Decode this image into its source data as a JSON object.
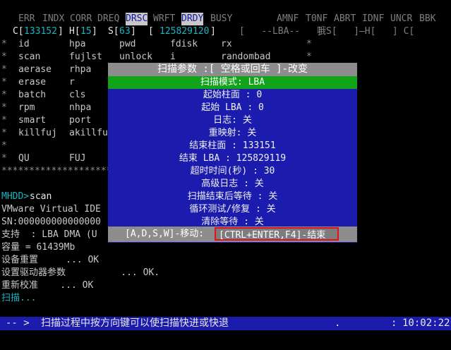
{
  "status_flags": {
    "err": "ERR",
    "indx": "INDX",
    "corr": "CORR",
    "dreq": "DREQ",
    "drsc": "DRSC",
    "wrft": "WRFT",
    "drdy": "DRDY",
    "busy": "BUSY",
    "amnf": "AMNF",
    "t0nf": "T0NF",
    "abrt": "ABRT",
    "idnf": "IDNF",
    "uncr": "UNCR",
    "bbk": "BBK"
  },
  "chs_line": {
    "c_label": "C[",
    "c_value": "133152",
    "c_close": "]",
    "h_label": "H[",
    "h_value": "15",
    "h_close": "]",
    "s_label": "S[",
    "s_value": "63",
    "s_close": "]",
    "lba_open": "[",
    "lba_value": "125829120",
    "lba_close": "]",
    "lba_box": "[   --LBA--   ]",
    "tail": "哦S[   ]—H[   ] C[       ]"
  },
  "command_menu": {
    "rows": [
      [
        "id",
        "hpa",
        "pwd",
        "fdisk",
        "rx"
      ],
      [
        "scan",
        "fujlst",
        "unlock",
        "i",
        "randombad"
      ],
      [
        "aerase",
        "rhpa",
        "",
        "",
        ""
      ],
      [
        "erase",
        "r",
        "",
        "",
        ""
      ],
      [
        "batch",
        "cls",
        "",
        "",
        ""
      ],
      [
        "rpm",
        "nhpa",
        "",
        "",
        ""
      ],
      [
        "smart",
        "port",
        "",
        "",
        ""
      ],
      [
        "killfuj",
        "akillfu",
        "",
        "",
        ""
      ],
      [
        "",
        "",
        "",
        "",
        ""
      ],
      [
        "QU",
        "FUJ",
        "",
        "",
        ""
      ]
    ],
    "star": "*",
    "separator": "**************************"
  },
  "console": {
    "prompt": "MHDD>",
    "command": "scan",
    "lines": [
      "VMware Virtual IDE",
      "SN:000000000000000",
      "支持  : LBA DMA (U",
      "容量 = 61439Mb",
      "设备重置     ... OK",
      "设置驱动器参数          ... OK.",
      "重新校准    ... OK",
      "扫描..."
    ]
  },
  "popup": {
    "title": "扫描参数     :[  空格或回车  ]-改变",
    "selected_row": "扫描模式: LBA",
    "rows": [
      "起始柱面   : 0",
      "起始 LBA   : 0",
      "日志: 关",
      "重映射: 关",
      "结束柱面   : 133151",
      "结束 LBA   : 125829119",
      "超时时间(秒) : 30",
      "高级日志   : 关",
      "扫描结束后等待   : 关",
      "循环测试/修复      : 关",
      "清除等待   : 关"
    ],
    "footer_left": "[A,D,S,W]-移动:",
    "footer_right": "[CTRL+ENTER,F4]-结束"
  },
  "bottom_bar": {
    "arrow": "-- >",
    "hint": "扫描过程中按方向键可以使扫描快进或快退",
    "dot": ".",
    "time_sep": ":",
    "time": "10:02:22"
  },
  "colors": {
    "status_highlight": "#c8c8c8",
    "popup_bg": "#1b1cad",
    "selected_row": "#11a41b",
    "footer_highlight_border": "#e0121d",
    "prompt": "#19b5c0"
  }
}
